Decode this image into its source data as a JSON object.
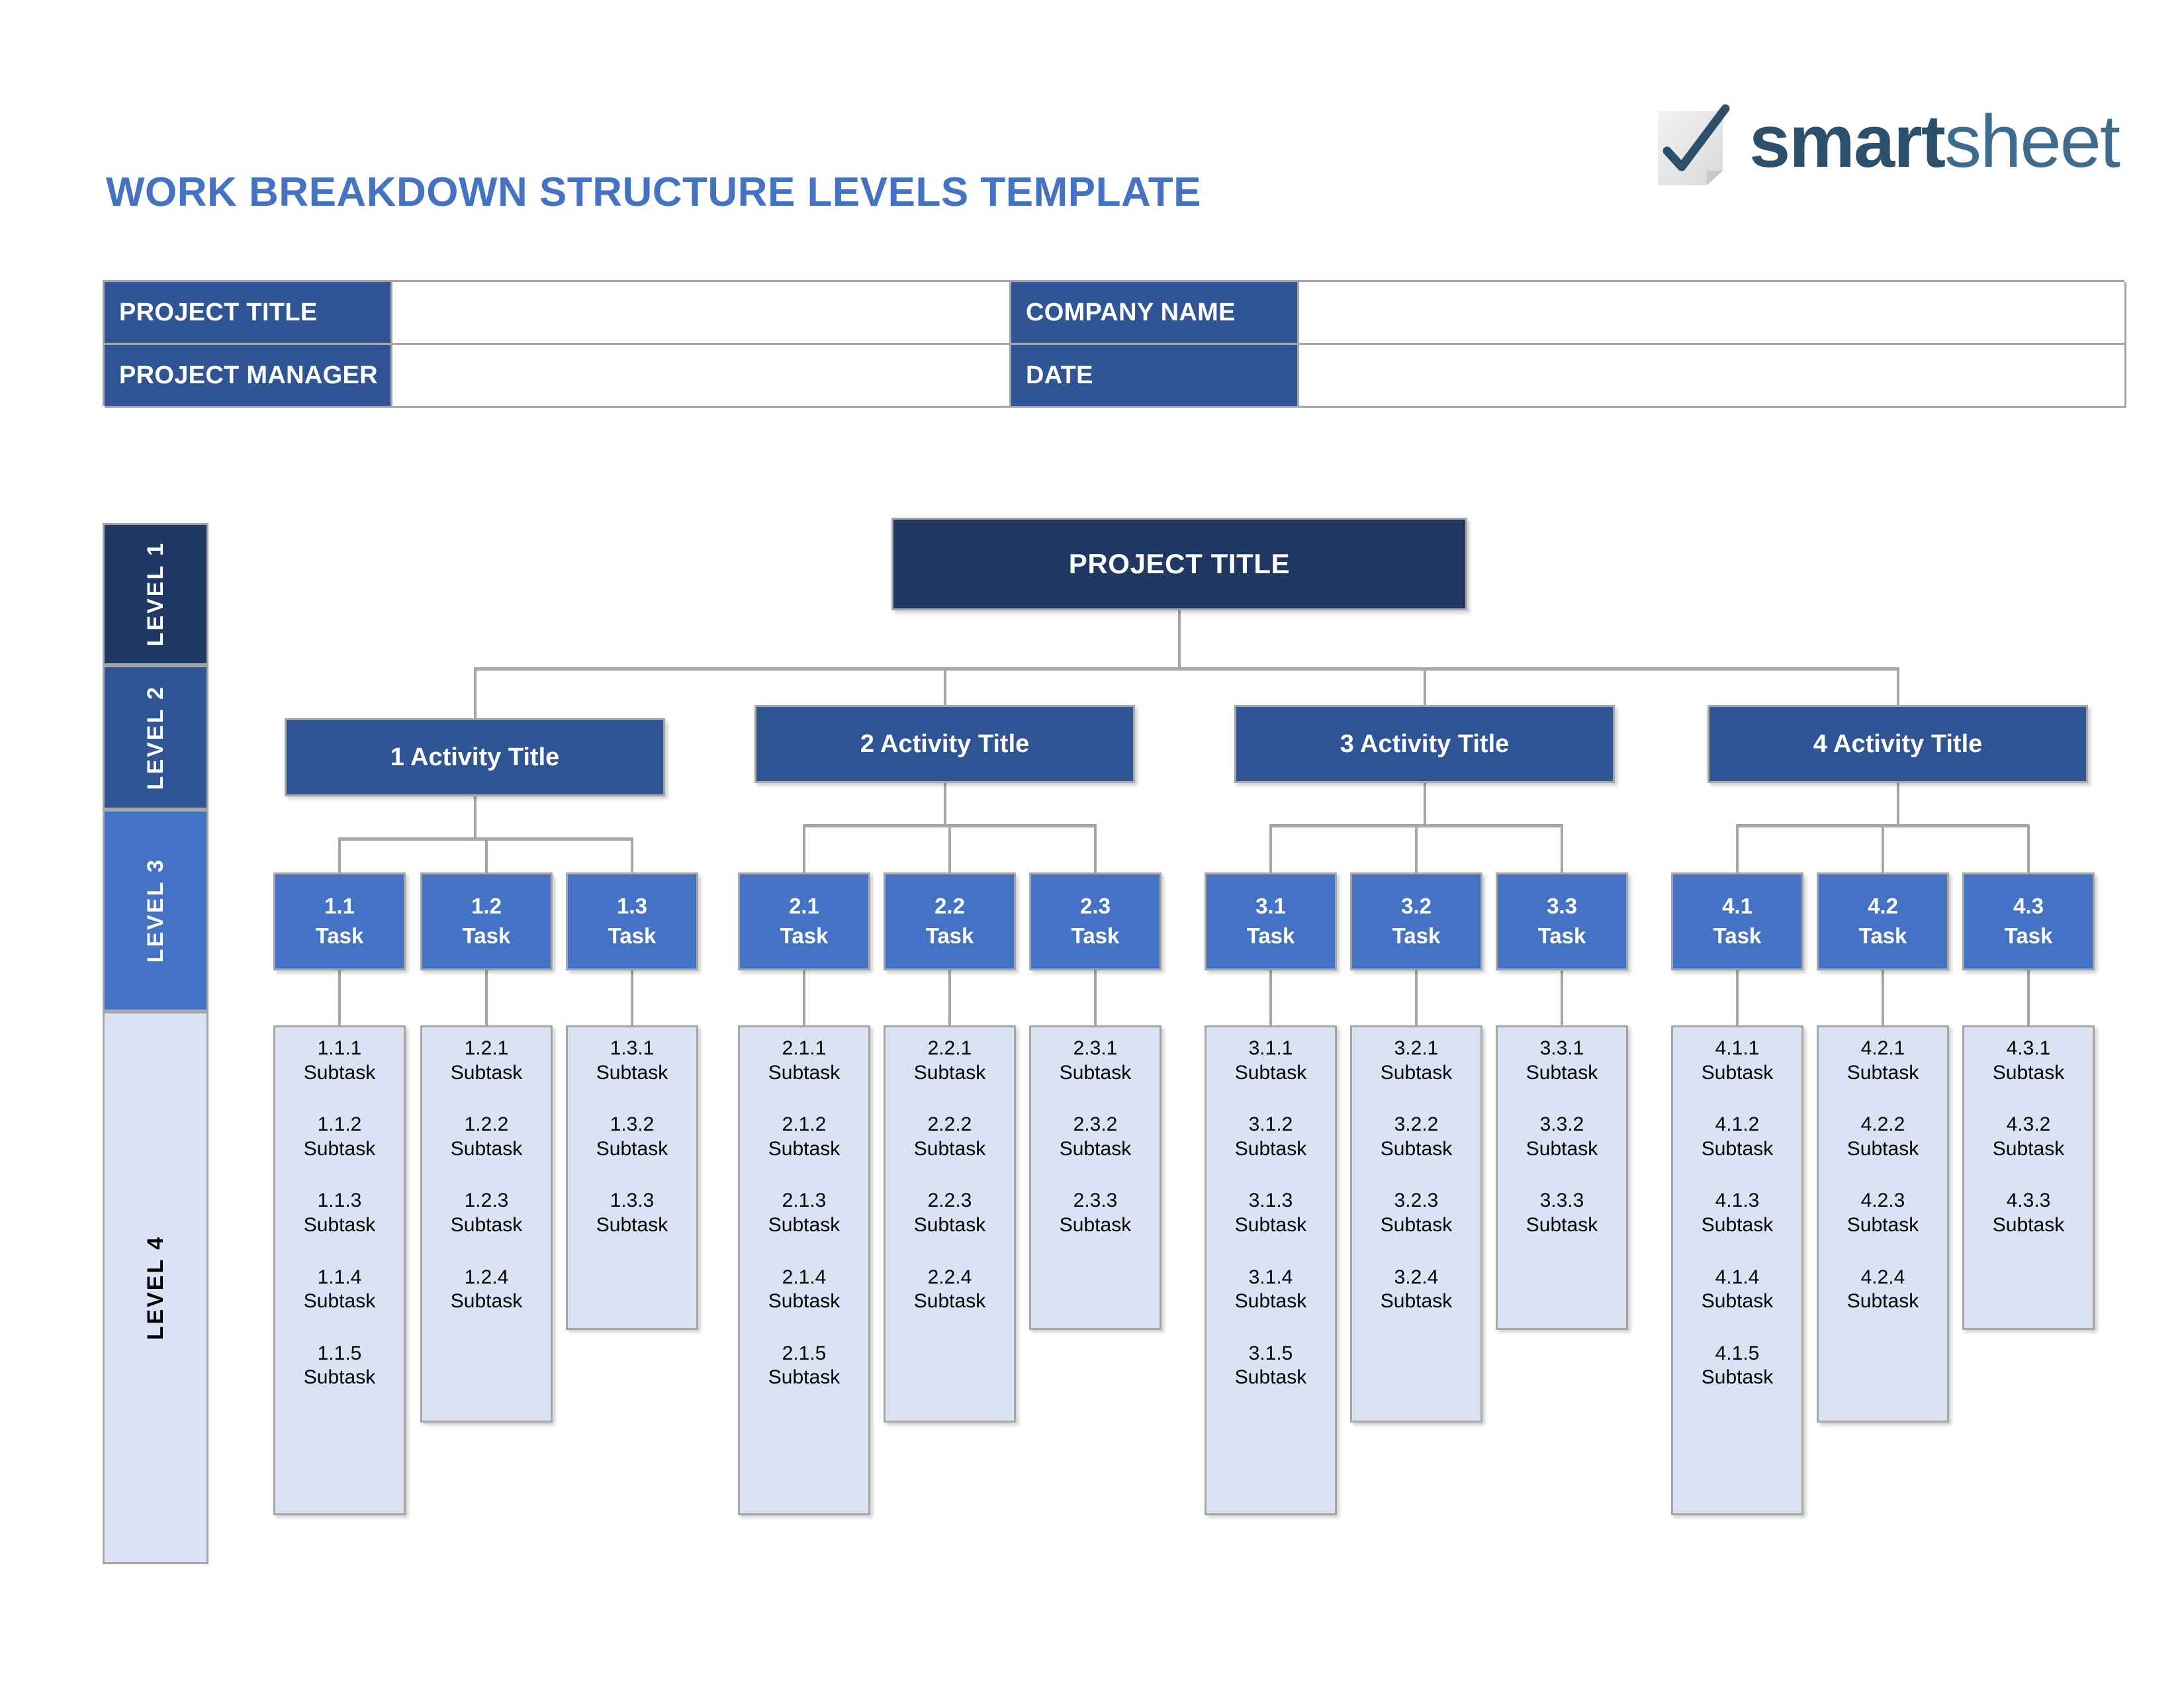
{
  "header": {
    "title": "WORK BREAKDOWN STRUCTURE LEVELS TEMPLATE",
    "title_color": "#4472C4",
    "logo": {
      "icon": "checkmark-page-icon",
      "word_bold": "smart",
      "word_light": "sheet"
    }
  },
  "info_table": {
    "rows": [
      {
        "label_left": "PROJECT TITLE",
        "value_left": "",
        "label_right": "COMPANY NAME",
        "value_right": ""
      },
      {
        "label_left": "PROJECT MANAGER",
        "value_left": "",
        "label_right": "DATE",
        "value_right": ""
      }
    ]
  },
  "levels": [
    {
      "label": "LEVEL 1",
      "color": "#203864",
      "text_color": "#FFFFFF"
    },
    {
      "label": "LEVEL 2",
      "color": "#2F5597",
      "text_color": "#FFFFFF"
    },
    {
      "label": "LEVEL 3",
      "color": "#4472C4",
      "text_color": "#FFFFFF"
    },
    {
      "label": "LEVEL 4",
      "color": "#DAE3F3",
      "text_color": "#000000"
    }
  ],
  "wbs": {
    "root": {
      "label": "PROJECT TITLE"
    },
    "activities": [
      {
        "label": "1 Activity Title",
        "tasks": [
          {
            "number": "1.1",
            "label": "Task",
            "subtasks": [
              {
                "number": "1.1.1",
                "label": "Subtask"
              },
              {
                "number": "1.1.2",
                "label": "Subtask"
              },
              {
                "number": "1.1.3",
                "label": "Subtask"
              },
              {
                "number": "1.1.4",
                "label": "Subtask"
              },
              {
                "number": "1.1.5",
                "label": "Subtask"
              }
            ]
          },
          {
            "number": "1.2",
            "label": "Task",
            "subtasks": [
              {
                "number": "1.2.1",
                "label": "Subtask"
              },
              {
                "number": "1.2.2",
                "label": "Subtask"
              },
              {
                "number": "1.2.3",
                "label": "Subtask"
              },
              {
                "number": "1.2.4",
                "label": "Subtask"
              }
            ]
          },
          {
            "number": "1.3",
            "label": "Task",
            "subtasks": [
              {
                "number": "1.3.1",
                "label": "Subtask"
              },
              {
                "number": "1.3.2",
                "label": "Subtask"
              },
              {
                "number": "1.3.3",
                "label": "Subtask"
              }
            ]
          }
        ]
      },
      {
        "label": "2 Activity Title",
        "tasks": [
          {
            "number": "2.1",
            "label": "Task",
            "subtasks": [
              {
                "number": "2.1.1",
                "label": "Subtask"
              },
              {
                "number": "2.1.2",
                "label": "Subtask"
              },
              {
                "number": "2.1.3",
                "label": "Subtask"
              },
              {
                "number": "2.1.4",
                "label": "Subtask"
              },
              {
                "number": "2.1.5",
                "label": "Subtask"
              }
            ]
          },
          {
            "number": "2.2",
            "label": "Task",
            "subtasks": [
              {
                "number": "2.2.1",
                "label": "Subtask"
              },
              {
                "number": "2.2.2",
                "label": "Subtask"
              },
              {
                "number": "2.2.3",
                "label": "Subtask"
              },
              {
                "number": "2.2.4",
                "label": "Subtask"
              }
            ]
          },
          {
            "number": "2.3",
            "label": "Task",
            "subtasks": [
              {
                "number": "2.3.1",
                "label": "Subtask"
              },
              {
                "number": "2.3.2",
                "label": "Subtask"
              },
              {
                "number": "2.3.3",
                "label": "Subtask"
              }
            ]
          }
        ]
      },
      {
        "label": "3 Activity Title",
        "tasks": [
          {
            "number": "3.1",
            "label": "Task",
            "subtasks": [
              {
                "number": "3.1.1",
                "label": "Subtask"
              },
              {
                "number": "3.1.2",
                "label": "Subtask"
              },
              {
                "number": "3.1.3",
                "label": "Subtask"
              },
              {
                "number": "3.1.4",
                "label": "Subtask"
              },
              {
                "number": "3.1.5",
                "label": "Subtask"
              }
            ]
          },
          {
            "number": "3.2",
            "label": "Task",
            "subtasks": [
              {
                "number": "3.2.1",
                "label": "Subtask"
              },
              {
                "number": "3.2.2",
                "label": "Subtask"
              },
              {
                "number": "3.2.3",
                "label": "Subtask"
              },
              {
                "number": "3.2.4",
                "label": "Subtask"
              }
            ]
          },
          {
            "number": "3.3",
            "label": "Task",
            "subtasks": [
              {
                "number": "3.3.1",
                "label": "Subtask"
              },
              {
                "number": "3.3.2",
                "label": "Subtask"
              },
              {
                "number": "3.3.3",
                "label": "Subtask"
              }
            ]
          }
        ]
      },
      {
        "label": "4 Activity Title",
        "tasks": [
          {
            "number": "4.1",
            "label": "Task",
            "subtasks": [
              {
                "number": "4.1.1",
                "label": "Subtask"
              },
              {
                "number": "4.1.2",
                "label": "Subtask"
              },
              {
                "number": "4.1.3",
                "label": "Subtask"
              },
              {
                "number": "4.1.4",
                "label": "Subtask"
              },
              {
                "number": "4.1.5",
                "label": "Subtask"
              }
            ]
          },
          {
            "number": "4.2",
            "label": "Task",
            "subtasks": [
              {
                "number": "4.2.1",
                "label": "Subtask"
              },
              {
                "number": "4.2.2",
                "label": "Subtask"
              },
              {
                "number": "4.2.3",
                "label": "Subtask"
              },
              {
                "number": "4.2.4",
                "label": "Subtask"
              }
            ]
          },
          {
            "number": "4.3",
            "label": "Task",
            "subtasks": [
              {
                "number": "4.3.1",
                "label": "Subtask"
              },
              {
                "number": "4.3.2",
                "label": "Subtask"
              },
              {
                "number": "4.3.3",
                "label": "Subtask"
              }
            ]
          }
        ]
      }
    ]
  },
  "colors": {
    "level1": "#203864",
    "level2": "#2F5597",
    "level3": "#4472C4",
    "level4": "#DAE3F3",
    "border": "#A6A6A6",
    "accent": "#4472C4"
  },
  "layout": {
    "activity_x": [
      430,
      1140,
      1865,
      2580
    ],
    "activity_y": [
      1085,
      1065,
      1065,
      1065
    ],
    "task_x": [
      413,
      635,
      855,
      1115,
      1335,
      1555,
      1820,
      2040,
      2260,
      2525,
      2745,
      2965
    ],
    "subtask_heights": [
      740,
      600,
      460
    ]
  }
}
